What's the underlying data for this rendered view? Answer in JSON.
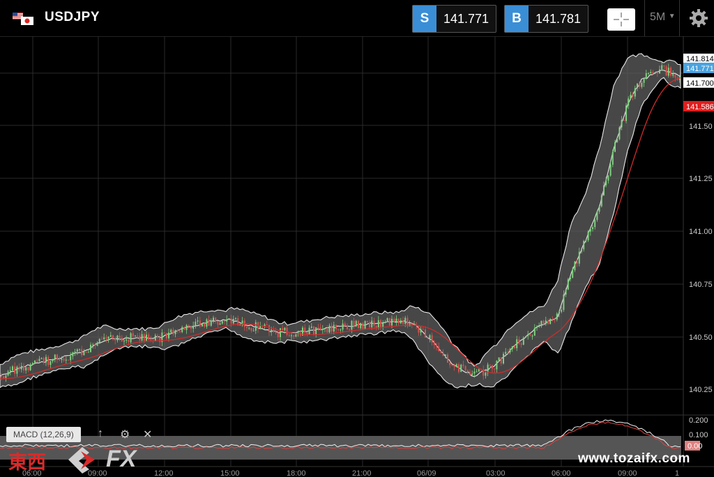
{
  "header": {
    "symbol": "USDJPY",
    "sell_tag": "S",
    "sell_price": "141.771",
    "buy_tag": "B",
    "buy_price": "141.781",
    "timeframe": "5M"
  },
  "price_axis": {
    "ticks": [
      "141.50",
      "141.25",
      "141.00",
      "140.75",
      "140.50",
      "140.25"
    ],
    "labels": {
      "high": "141.814",
      "current": "141.771",
      "mid": "141.700",
      "ma": "141.586"
    }
  },
  "time_axis": {
    "ticks": [
      "06:00",
      "09:00",
      "12:00",
      "15:00",
      "18:00",
      "21:00",
      "06/09",
      "03:00",
      "06:00",
      "09:00",
      "1"
    ]
  },
  "macd": {
    "label": "MACD (12,26,9)",
    "ticks": [
      "0.200",
      "0.100",
      "0.00"
    ]
  },
  "watermark": {
    "logo_jp": "東西",
    "logo_fx": "FX",
    "url": "www.tozaifx.com"
  },
  "colors": {
    "accent": "#3a8ed6",
    "bull": "#7fd07f",
    "bear": "#d95050",
    "ma": "#d12b2b",
    "current_label": "#4aa3df",
    "ma_label": "#e01e1e"
  }
}
